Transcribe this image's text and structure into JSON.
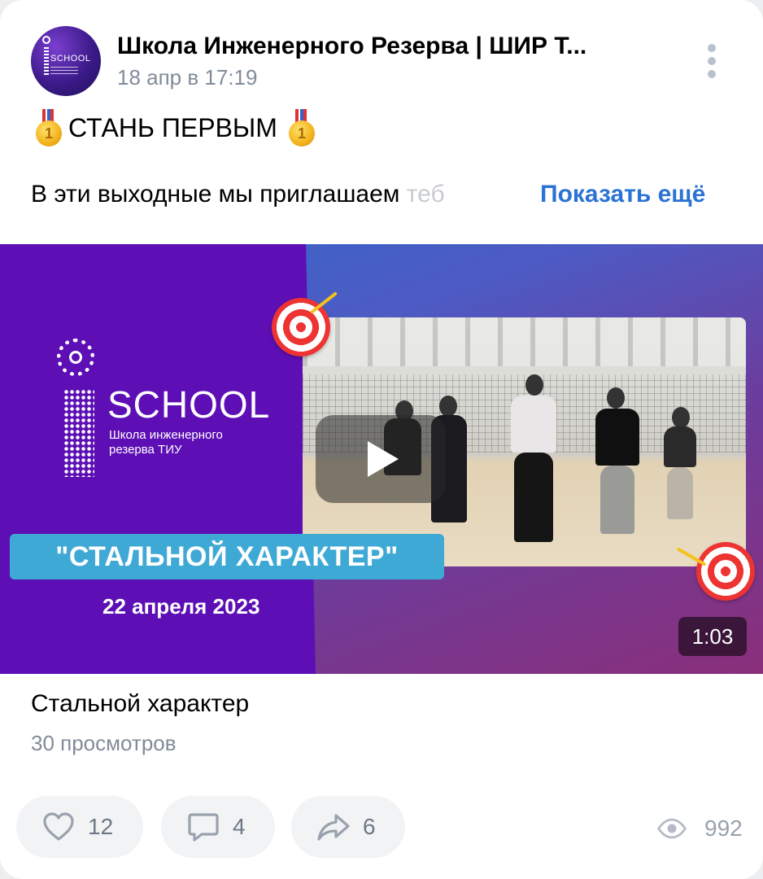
{
  "post": {
    "author": "Школа Инженерного Резерва | ШИР Т...",
    "date": "18 апр в 17:19",
    "headline": "СТАНЬ ПЕРВЫМ",
    "text_visible": "В эти выходные мы приглашаем ",
    "text_faded": "теб",
    "show_more": "Показать ещё"
  },
  "avatar": {
    "label": "SCHOOL"
  },
  "video": {
    "school_word": "SCHOOL",
    "school_sub": "Школа инженерного резерва ТИУ",
    "banner": "\"СТАЛЬНОЙ ХАРАКТЕР\"",
    "date": "22 апреля 2023",
    "duration": "1:03",
    "title": "Стальной характер",
    "views": "30 просмотров"
  },
  "actions": {
    "likes": "12",
    "comments": "4",
    "shares": "6",
    "view_count": "992"
  },
  "colors": {
    "link": "#2a73d4",
    "secondary_text": "#818c99",
    "thumb_purple": "#5d0fb5",
    "banner": "#3fa9d6"
  },
  "icons": [
    "more-vertical-icon",
    "medal-icon",
    "play-icon",
    "heart-icon",
    "comment-icon",
    "share-icon",
    "eye-icon"
  ]
}
